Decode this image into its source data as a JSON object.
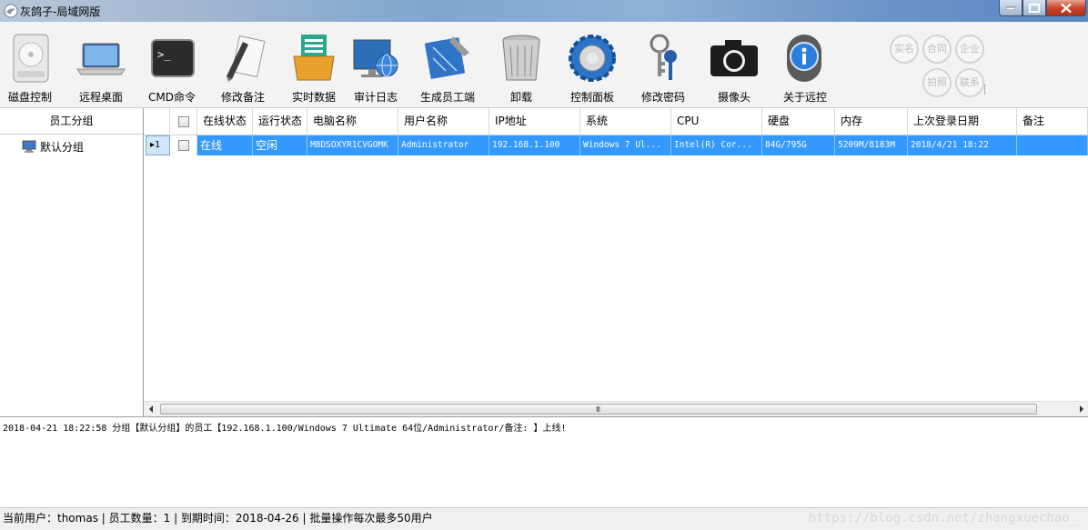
{
  "window": {
    "title": "灰鸽子-局域网版"
  },
  "toolbar": {
    "items": [
      {
        "label": "磁盘控制",
        "icon": "disk-icon"
      },
      {
        "label": "远程桌面",
        "icon": "laptop-icon"
      },
      {
        "label": "CMD命令",
        "icon": "terminal-icon"
      },
      {
        "label": "修改备注",
        "icon": "pen-icon"
      },
      {
        "label": "实时数据",
        "icon": "folder-data-icon"
      },
      {
        "label": "审计日志",
        "icon": "monitor-globe-icon"
      },
      {
        "label": "生成员工端",
        "icon": "blueprint-icon"
      },
      {
        "label": "卸载",
        "icon": "trash-icon"
      },
      {
        "label": "控制面板",
        "icon": "gear-icon"
      },
      {
        "label": "修改密码",
        "icon": "keys-icon"
      },
      {
        "label": "摄像头",
        "icon": "camera-icon"
      },
      {
        "label": "关于远控",
        "icon": "info-icon"
      }
    ],
    "badges": [
      "实名",
      "合同",
      "企业",
      "拍照",
      "联系"
    ]
  },
  "left_panel": {
    "header": "员工分组",
    "groups": [
      {
        "label": "默认分组",
        "icon": "computer-icon"
      }
    ]
  },
  "grid": {
    "columns": [
      "",
      "在线状态",
      "运行状态",
      "电脑名称",
      "用户名称",
      "IP地址",
      "系统",
      "CPU",
      "硬盘",
      "内存",
      "上次登录日期",
      "备注"
    ],
    "rows": [
      {
        "row_number": "1",
        "online": "在线",
        "run_state": "空闲",
        "computer": "MBDSOXYR1CVGOMK",
        "user": "Administrator",
        "ip": "192.168.1.100",
        "os": "Windows 7 Ul...",
        "cpu": "Intel(R) Cor...",
        "disk": "84G/795G",
        "memory": "5209M/8183M",
        "last_login": "2018/4/21 18:22",
        "note": ""
      }
    ],
    "scroll_grip": "III"
  },
  "log": {
    "lines": [
      "2018-04-21  18:22:58 分组【默认分组】的员工【192.168.1.100/Windows 7  Ultimate 64位/Administrator/备注: 】上线!"
    ]
  },
  "status": {
    "text": "当前用户：thomas | 员工数量：1 | 到期时间：2018-04-26 | 批量操作每次最多50用户",
    "watermark": "https://blog.csdn.net/zhangxuechao_"
  },
  "colors": {
    "selection": "#3399ff",
    "titlebar": "#7fa6d1"
  }
}
